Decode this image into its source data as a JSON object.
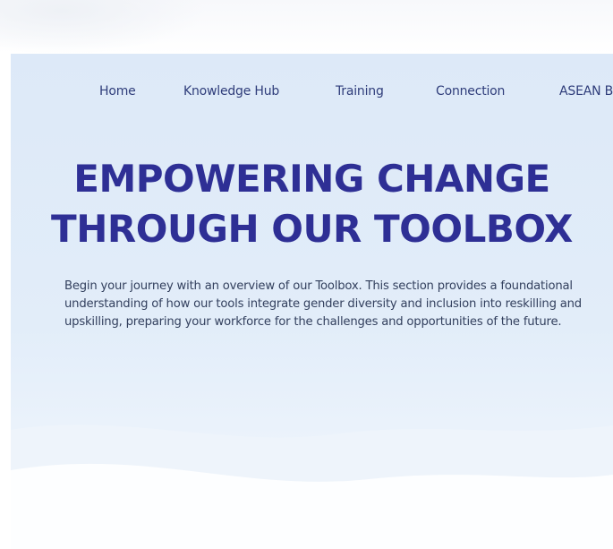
{
  "nav": {
    "items": [
      "Home",
      "Knowledge Hub",
      "Training",
      "Connection",
      "ASEAN B"
    ]
  },
  "hero": {
    "title_line1": "EMPOWERING CHANGE",
    "title_line2": "THROUGH OUR TOOLBOX",
    "description": "Begin your journey with an overview of our Toolbox. This section provides a foundational understanding of how our tools integrate gender diversity and inclusion into reskilling and upskilling, preparing your workforce for the challenges and opportunities of the future."
  },
  "colors": {
    "title": "#2e2f95",
    "nav_text": "#2f3d7a",
    "hero_bg": "#dde9f8"
  }
}
